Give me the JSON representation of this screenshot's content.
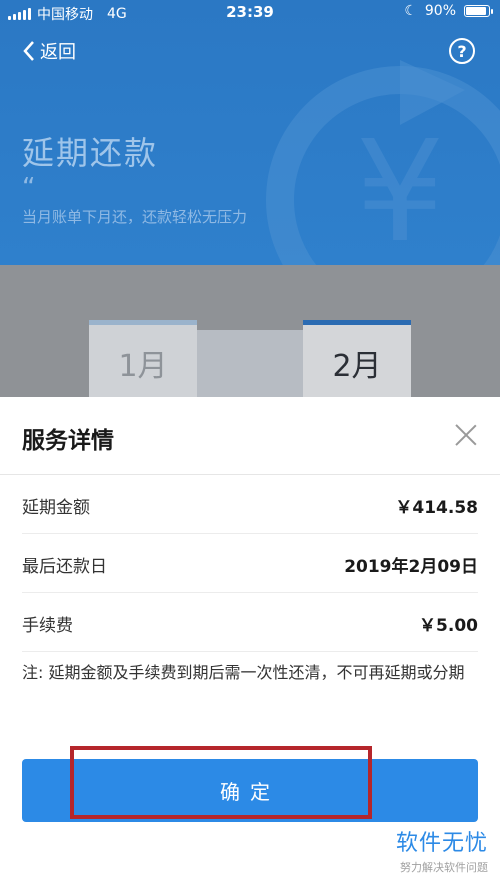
{
  "status_bar": {
    "carrier": "中国移动",
    "network": "4G",
    "time": "23:39",
    "battery": "90%",
    "battery_level": 0.9
  },
  "nav": {
    "back_label": "返回",
    "help_label": "?"
  },
  "hero": {
    "title": "延期还款",
    "quote_mark": "“",
    "subtitle": "当月账单下月还，还款轻松无压力"
  },
  "months": [
    {
      "label": "1月",
      "selected": false
    },
    {
      "label": "2月",
      "selected": true
    }
  ],
  "sheet": {
    "title": "服务详情",
    "rows": [
      {
        "label": "延期金额",
        "value": "￥414.58"
      },
      {
        "label": "最后还款日",
        "value": "2019年2月09日"
      },
      {
        "label": "手续费",
        "value": "￥5.00"
      }
    ],
    "note": "注: 延期金额及手续费到期后需一次性还清，不可再延期或分期",
    "confirm_label": "确定"
  },
  "watermark": {
    "main": "软件无忧",
    "sub": "努力解决软件问题"
  },
  "colors": {
    "primary": "#2c8ae6",
    "header_blue": "#2b78c4",
    "highlight": "#b5262b"
  }
}
